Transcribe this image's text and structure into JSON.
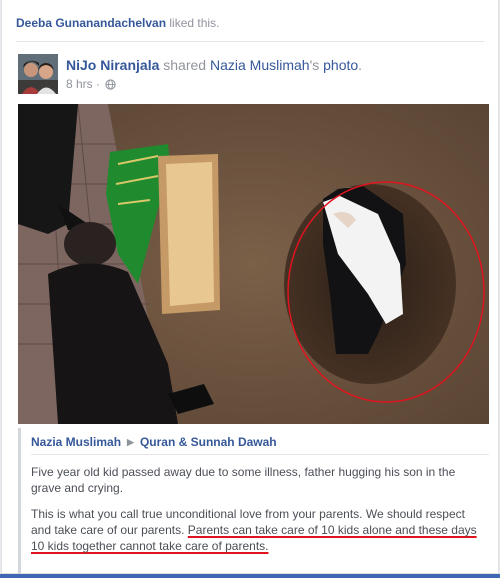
{
  "activity": {
    "name": "Deeba Gunanandachelvan",
    "action": " liked this."
  },
  "post": {
    "actor": "NiJo Niranjala",
    "verb": " shared ",
    "source_name": "Nazia Muslimah",
    "source_suffix": "'s ",
    "object": "photo",
    "end": ".",
    "time": "8 hrs",
    "separator": " · ",
    "privacy_icon": "globe-icon"
  },
  "attribution": {
    "page": "Nazia Muslimah",
    "arrow_icon": "triangle-right-icon",
    "target": "Quran & Sunnah Dawah"
  },
  "text": {
    "para1": "Five year old kid passed away due to some illness, father hugging his son in the grave and crying.",
    "para2_plain": "This is what you call true unconditional love from your parents. We should respect and take care of our parents. ",
    "para2_underlined": "Parents can take care of 10 kids alone and these days 10 kids together cannot take care of parents."
  },
  "colors": {
    "link": "#365899",
    "muted": "#90949c",
    "annotation": "#e0141e",
    "brand_bar": "#4267b2"
  }
}
